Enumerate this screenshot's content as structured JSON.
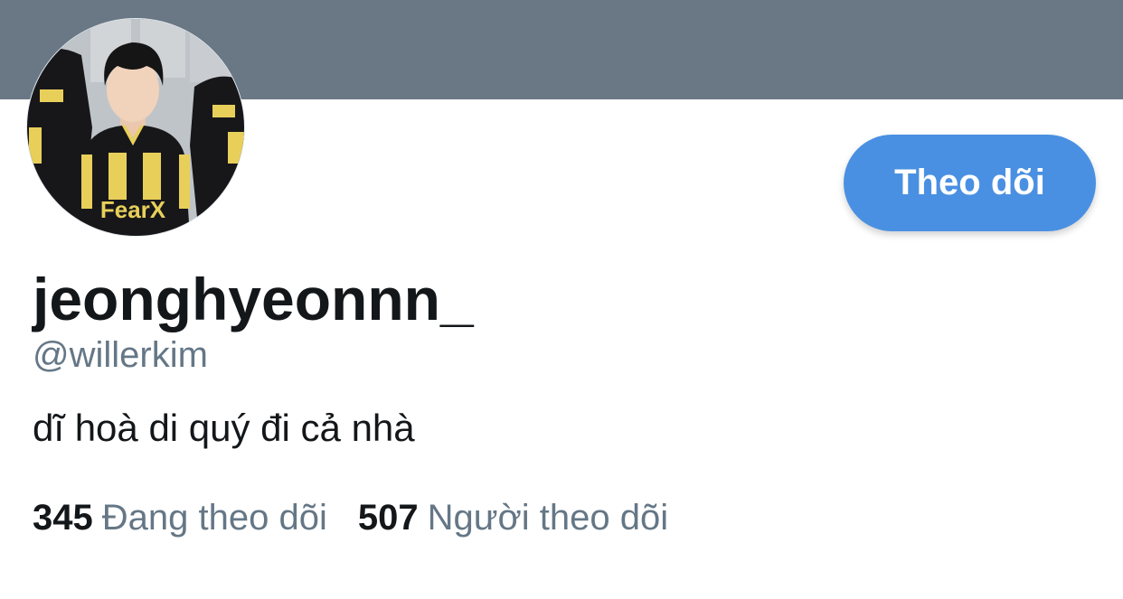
{
  "colors": {
    "banner": "#6a7785",
    "accent": "#4a90e2",
    "text_primary": "#14171a",
    "text_secondary": "#657786"
  },
  "profile": {
    "avatar_icon": "profile-photo",
    "avatar_jersey_text": "FearX",
    "display_name": "jeonghyeonnn_",
    "handle": "@willerkim",
    "bio": "dĩ hoà di quý đi cả nhà"
  },
  "actions": {
    "follow_label": "Theo dõi"
  },
  "stats": {
    "following_count": "345",
    "following_label": "Đang theo dõi",
    "followers_count": "507",
    "followers_label": "Người theo dõi"
  }
}
